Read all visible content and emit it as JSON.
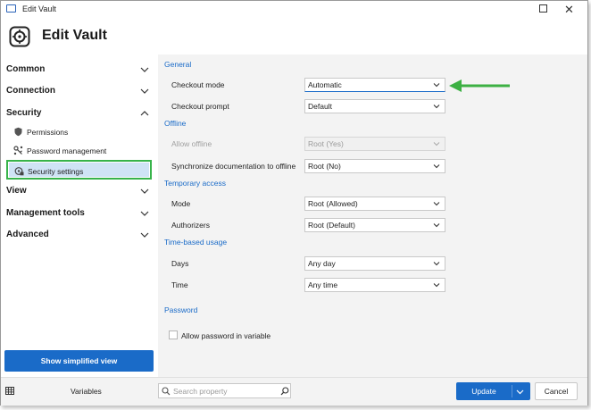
{
  "window": {
    "title": "Edit Vault",
    "heading": "Edit Vault"
  },
  "sidebar": {
    "sections": [
      {
        "label": "Common",
        "expanded": false
      },
      {
        "label": "Connection",
        "expanded": false
      },
      {
        "label": "Security",
        "expanded": true
      },
      {
        "label": "View",
        "expanded": false
      },
      {
        "label": "Management tools",
        "expanded": false
      },
      {
        "label": "Advanced",
        "expanded": false
      }
    ],
    "security_items": [
      {
        "label": "Permissions",
        "icon": "shield-icon"
      },
      {
        "label": "Password management",
        "icon": "key-icon"
      },
      {
        "label": "Security settings",
        "icon": "lock-gear-icon",
        "selected": true
      }
    ],
    "simplified_view_button": "Show simplified view"
  },
  "main": {
    "groups": {
      "general": "General",
      "offline": "Offline",
      "temporary_access": "Temporary access",
      "time_based_usage": "Time-based usage",
      "password": "Password"
    },
    "fields": {
      "checkout_mode": {
        "label": "Checkout mode",
        "value": "Automatic"
      },
      "checkout_prompt": {
        "label": "Checkout prompt",
        "value": "Default"
      },
      "allow_offline": {
        "label": "Allow offline",
        "value": "Root (Yes)",
        "disabled": true
      },
      "sync_documentation": {
        "label": "Synchronize documentation to offline",
        "value": "Root (No)"
      },
      "mode": {
        "label": "Mode",
        "value": "Root (Allowed)"
      },
      "authorizers": {
        "label": "Authorizers",
        "value": "Root (Default)"
      },
      "days": {
        "label": "Days",
        "value": "Any day"
      },
      "time": {
        "label": "Time",
        "value": "Any time"
      },
      "allow_password_in_variable": {
        "label": "Allow password in variable",
        "checked": false
      }
    }
  },
  "footer": {
    "variables_label": "Variables",
    "search_placeholder": "Search property",
    "update_label": "Update",
    "cancel_label": "Cancel"
  },
  "colors": {
    "accent": "#1a6bc8",
    "highlight_border": "#37b34a",
    "annotation_arrow": "#3cb043",
    "selected_bg": "#cfe3f5"
  }
}
